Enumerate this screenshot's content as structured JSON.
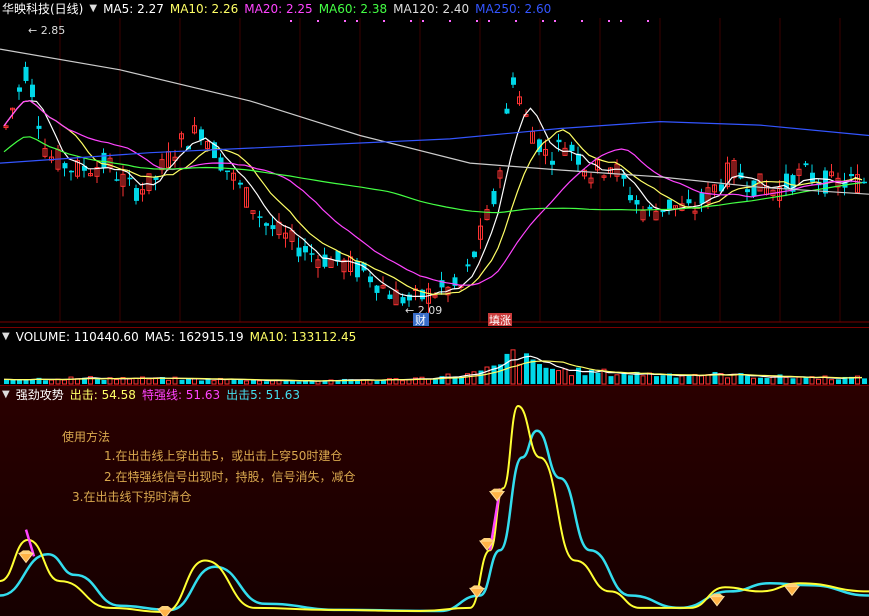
{
  "price_panel": {
    "title": "华映科技(日线)",
    "legend": [
      {
        "label": "MA5: 2.27",
        "color": "#ffffff"
      },
      {
        "label": "MA10: 2.26",
        "color": "#ffff66"
      },
      {
        "label": "MA20: 2.25",
        "color": "#ff44ff"
      },
      {
        "label": "MA60: 2.38",
        "color": "#44ff44"
      },
      {
        "label": "MA120: 2.40",
        "color": "#dddddd"
      },
      {
        "label": "MA250: 2.60",
        "color": "#3355ff"
      }
    ],
    "high_label": "2.85",
    "low_label": "2.09",
    "high_arrow": "←",
    "low_arrow": "←",
    "badge_left": "财",
    "badge_right": "填涨",
    "colors": {
      "up": "#ff3333",
      "down": "#00d8e8",
      "ma5": "#ffffff",
      "ma10": "#ffff66",
      "ma20": "#ff44ff",
      "ma60": "#44ff44",
      "ma120": "#cccccc",
      "ma250": "#3355ff"
    }
  },
  "volume_panel": {
    "legend": [
      {
        "label": "VOLUME: 110440.60",
        "color": "#ffffff"
      },
      {
        "label": "MA5: 162915.19",
        "color": "#ffffff"
      },
      {
        "label": "MA10: 133112.45",
        "color": "#ffff66"
      }
    ]
  },
  "indicator_panel": {
    "legend": [
      {
        "label": "强劲攻势",
        "color": "#ffffff"
      },
      {
        "label": "出击: 54.58",
        "color": "#ffff66"
      },
      {
        "label": "特强线: 51.63",
        "color": "#ff44ff"
      },
      {
        "label": "出击5: 51.63",
        "color": "#44ddee"
      }
    ],
    "notes": {
      "title": "使用方法",
      "line1": "1.在出击线上穿出击5，或出击上穿50时建仓",
      "line2": "2.在特强线信号出现时，持股，信号消失，减仓",
      "line3": "3.在出击线下拐时清仓"
    },
    "colors": {
      "chuji": "#ffff33",
      "chuji5": "#33ddee",
      "strong": "#ff44ff",
      "signal": "#ffb347"
    }
  },
  "chart_data": {
    "type": "candlestick",
    "y_range_visible": [
      2.09,
      2.85
    ],
    "price_path": [
      [
        0,
        2.57
      ],
      [
        25,
        2.78
      ],
      [
        45,
        2.52
      ],
      [
        75,
        2.48
      ],
      [
        105,
        2.5
      ],
      [
        130,
        2.42
      ],
      [
        150,
        2.44
      ],
      [
        175,
        2.55
      ],
      [
        200,
        2.6
      ],
      [
        220,
        2.5
      ],
      [
        240,
        2.42
      ],
      [
        265,
        2.32
      ],
      [
        290,
        2.27
      ],
      [
        315,
        2.23
      ],
      [
        340,
        2.21
      ],
      [
        365,
        2.18
      ],
      [
        390,
        2.12
      ],
      [
        410,
        2.1
      ],
      [
        435,
        2.13
      ],
      [
        460,
        2.14
      ],
      [
        480,
        2.3
      ],
      [
        495,
        2.42
      ],
      [
        510,
        2.76
      ],
      [
        525,
        2.62
      ],
      [
        545,
        2.52
      ],
      [
        565,
        2.56
      ],
      [
        590,
        2.47
      ],
      [
        610,
        2.5
      ],
      [
        630,
        2.4
      ],
      [
        645,
        2.35
      ],
      [
        665,
        2.38
      ],
      [
        690,
        2.36
      ],
      [
        710,
        2.42
      ],
      [
        730,
        2.48
      ],
      [
        750,
        2.44
      ],
      [
        775,
        2.42
      ],
      [
        800,
        2.47
      ],
      [
        830,
        2.44
      ],
      [
        869,
        2.45
      ]
    ],
    "volume_path": [
      [
        0,
        0.16
      ],
      [
        100,
        0.18
      ],
      [
        200,
        0.15
      ],
      [
        300,
        0.1
      ],
      [
        400,
        0.14
      ],
      [
        470,
        0.3
      ],
      [
        495,
        0.5
      ],
      [
        512,
        0.95
      ],
      [
        530,
        0.62
      ],
      [
        560,
        0.4
      ],
      [
        600,
        0.35
      ],
      [
        650,
        0.3
      ],
      [
        700,
        0.3
      ],
      [
        780,
        0.22
      ],
      [
        869,
        0.18
      ]
    ],
    "series": [
      {
        "name": "出击",
        "values": [
          [
            0,
            15
          ],
          [
            28,
            35
          ],
          [
            60,
            15
          ],
          [
            110,
            2
          ],
          [
            165,
            0
          ],
          [
            205,
            25
          ],
          [
            255,
            2
          ],
          [
            330,
            1
          ],
          [
            420,
            0.5
          ],
          [
            470,
            2
          ],
          [
            490,
            30
          ],
          [
            503,
            60
          ],
          [
            518,
            100
          ],
          [
            540,
            75
          ],
          [
            575,
            25
          ],
          [
            610,
            10
          ],
          [
            640,
            2
          ],
          [
            690,
            2
          ],
          [
            725,
            12
          ],
          [
            760,
            10
          ],
          [
            800,
            14
          ],
          [
            869,
            10
          ]
        ]
      },
      {
        "name": "出击5",
        "values": [
          [
            0,
            8
          ],
          [
            48,
            28
          ],
          [
            75,
            18
          ],
          [
            120,
            3
          ],
          [
            170,
            1
          ],
          [
            215,
            22
          ],
          [
            265,
            4
          ],
          [
            340,
            1
          ],
          [
            440,
            0.5
          ],
          [
            480,
            8
          ],
          [
            500,
            30
          ],
          [
            522,
            75
          ],
          [
            537,
            88
          ],
          [
            560,
            65
          ],
          [
            590,
            30
          ],
          [
            630,
            8
          ],
          [
            680,
            2
          ],
          [
            730,
            10
          ],
          [
            770,
            14
          ],
          [
            810,
            13
          ],
          [
            869,
            8
          ]
        ]
      },
      {
        "name": "特强线",
        "values": [
          [
            26,
            40
          ],
          [
            34,
            27
          ],
          [
            490,
            30
          ],
          [
            500,
            60
          ]
        ]
      }
    ],
    "signals": [
      [
        26,
        27
      ],
      [
        165,
        0
      ],
      [
        477,
        10
      ],
      [
        487,
        33
      ],
      [
        497,
        57
      ],
      [
        717,
        6
      ],
      [
        792,
        11
      ]
    ]
  }
}
